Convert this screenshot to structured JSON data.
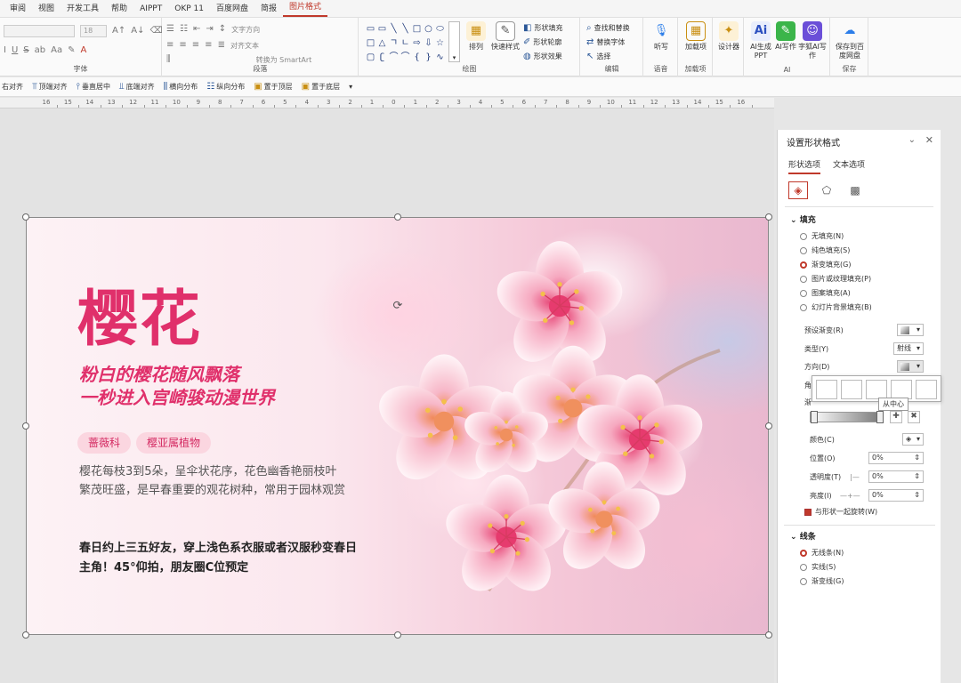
{
  "menu": {
    "items": [
      "审阅",
      "视图",
      "开发工具",
      "帮助",
      "AIPPT",
      "OKP 11",
      "百度网盘",
      "简报",
      "图片格式"
    ],
    "active_index": 8
  },
  "ribbon": {
    "font": {
      "size_value": "18",
      "label": "字体",
      "buttons": [
        "A↑",
        "A↓",
        "I",
        "U",
        "S",
        "ab",
        "Aa",
        "A"
      ]
    },
    "paragraph": {
      "label": "段落",
      "text_direction": "文字方向",
      "align_text": "对齐文本",
      "smartart": "转换为 SmartArt"
    },
    "drawing": {
      "label": "绘图",
      "arrange": "排列",
      "quick_styles": "快速样式",
      "shape_fill": "形状填充",
      "shape_outline": "形状轮廓",
      "shape_effects": "形状效果"
    },
    "editing": {
      "label": "编辑",
      "find_replace": "查找和替换",
      "replace_font": "替换字体",
      "select": "选择"
    },
    "voice": {
      "label": "语音",
      "dictate": "听写"
    },
    "addins": {
      "label": "加载项",
      "addin": "加载项"
    },
    "designer": {
      "label": "设计器"
    },
    "ai": {
      "label": "AI",
      "ai_ppt": "AI生成PPT",
      "ai_write": "AI写作",
      "ai_assist": "字狐AI写作"
    },
    "save": {
      "label": "保存",
      "save_baidu": "保存到百度网盘"
    }
  },
  "toolbar2": [
    "右对齐",
    "顶端对齐",
    "垂直居中",
    "底端对齐",
    "横向分布",
    "纵向分布",
    "置于顶层",
    "置于底层"
  ],
  "ruler": {
    "ticks": [
      "16",
      "15",
      "14",
      "13",
      "12",
      "11",
      "10",
      "9",
      "8",
      "7",
      "6",
      "5",
      "4",
      "3",
      "2",
      "1",
      "0",
      "1",
      "2",
      "3",
      "4",
      "5",
      "6",
      "7",
      "8",
      "9",
      "10",
      "11",
      "12",
      "13",
      "14",
      "15",
      "16"
    ]
  },
  "slide": {
    "title": "樱花",
    "subtitle_line1": "粉白的樱花随风飘落",
    "subtitle_line2": "一秒进入宫崎骏动漫世界",
    "tags": [
      "蔷薇科",
      "樱亚属植物"
    ],
    "description": "樱花每枝3到5朵，呈伞状花序，花色幽香艳丽枝叶繁茂旺盛，是早春重要的观花树种，常用于园林观赏",
    "highlight": "春日约上三五好友，穿上浅色系衣服或者汉服秒变春日主角！45°仰拍，朋友圈C位预定"
  },
  "panel": {
    "title": "设置形状格式",
    "tabs": [
      "形状选项",
      "文本选项"
    ],
    "fill_section": "填充",
    "fill_options": [
      "无填充(N)",
      "纯色填充(S)",
      "渐变填充(G)",
      "图片或纹理填充(P)",
      "图案填充(A)",
      "幻灯片背景填充(B)"
    ],
    "fill_selected": 2,
    "preset_gradient": "预设渐变(R)",
    "type_label": "类型(Y)",
    "type_value": "射线",
    "direction_label": "方向(D)",
    "angle_label": "角",
    "stops_label": "渐",
    "tooltip": "从中心",
    "color_label": "颜色(C)",
    "position_label": "位置(O)",
    "position_value": "0%",
    "transparency_label": "透明度(T)",
    "transparency_value": "0%",
    "brightness_label": "亮度(I)",
    "brightness_value": "0%",
    "rotate_with_shape": "与形状一起旋转(W)",
    "line_section": "线条",
    "line_options": [
      "无线条(N)",
      "实线(S)",
      "渐变线(G)"
    ],
    "line_selected": 0
  },
  "colors": {
    "accent": "#c0392b",
    "title_pink": "#e0306b",
    "tag_bg": "#fbd6e0"
  }
}
